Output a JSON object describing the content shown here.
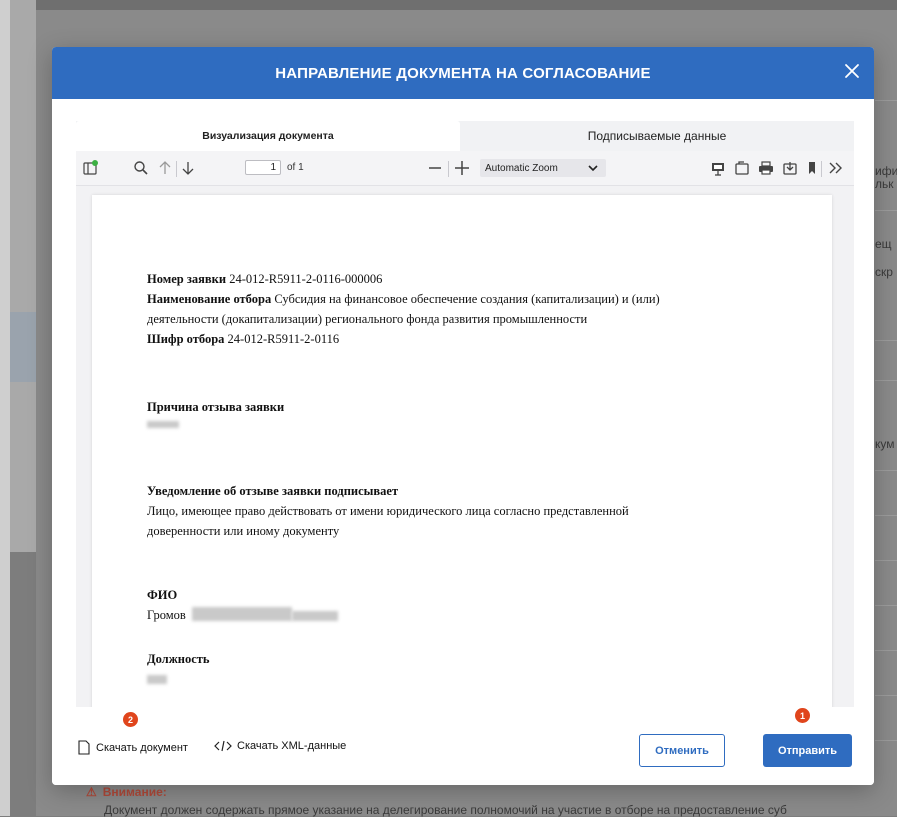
{
  "background": {
    "right_fragments": [
      "ифи",
      "льк",
      "ещ",
      "скр",
      "кум"
    ],
    "warning_title": "Внимание:",
    "warning_text": "Документ должен содержать прямое указание на делегирование полномочий на участие в отборе на предоставление суб"
  },
  "modal": {
    "title": "НАПРАВЛЕНИЕ ДОКУМЕНТА НА СОГЛАСОВАНИЕ",
    "tabs": [
      {
        "label": "Визуализация документа",
        "active": true
      },
      {
        "label": "Подписываемые данные",
        "active": false
      }
    ],
    "viewer": {
      "page_number": "1",
      "page_of": "of 1",
      "zoom": "Automatic Zoom",
      "doc": {
        "number_label": "Номер заявки",
        "number_value": "24-012-R5911-2-0116-000006",
        "selection_label": "Наименование отбора",
        "selection_value_line1": "Субсидия на финансовое обеспечение создания (капитализации) и (или)",
        "selection_value_line2": "деятельности (докапитализации) регионального фонда развития промышленности",
        "cipher_label": "Шифр отбора",
        "cipher_value": "24-012-R5911-2-0116",
        "reason_label": "Причина отзыва заявки",
        "notice_label": "Уведомление об отзыве заявки подписывает",
        "notice_line1": "Лицо, имеющее право действовать от имени юридического лица согласно представленной",
        "notice_line2": "доверенности или иному документу",
        "fio_label": "ФИО",
        "fio_value": "Громов",
        "position_label": "Должность"
      }
    },
    "footer": {
      "download_doc": "Скачать документ",
      "download_xml": "Скачать XML-данные",
      "cancel": "Отменить",
      "send": "Отправить",
      "badges": [
        "2",
        "1"
      ]
    }
  },
  "colors": {
    "accent": "#2f6cc0",
    "badge": "#e0451c"
  }
}
